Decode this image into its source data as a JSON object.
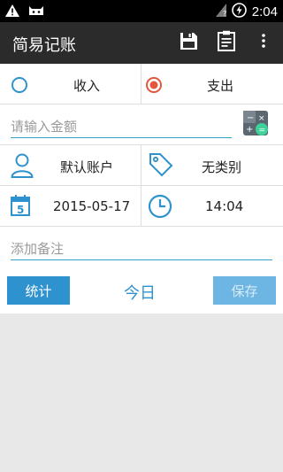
{
  "status_bar": {
    "time": "2:04"
  },
  "app_bar": {
    "title": "简易记账"
  },
  "type_row": {
    "income_label": "收入",
    "expense_label": "支出",
    "selected": "expense"
  },
  "amount": {
    "placeholder": "请输入金额"
  },
  "account_row": {
    "account_label": "默认账户",
    "category_label": "无类别"
  },
  "datetime_row": {
    "date": "2015-05-17",
    "calendar_day": "5",
    "time": "14:04"
  },
  "note": {
    "placeholder": "添加备注"
  },
  "actions": {
    "stats_label": "统计",
    "today_label": "今日",
    "save_label": "保存"
  },
  "colors": {
    "accent": "#35a1cf",
    "primary_button": "#2e92cf",
    "disabled_button": "#6db5e3",
    "radio_selected": "#e2583e",
    "appbar": "#2b2b2b"
  }
}
